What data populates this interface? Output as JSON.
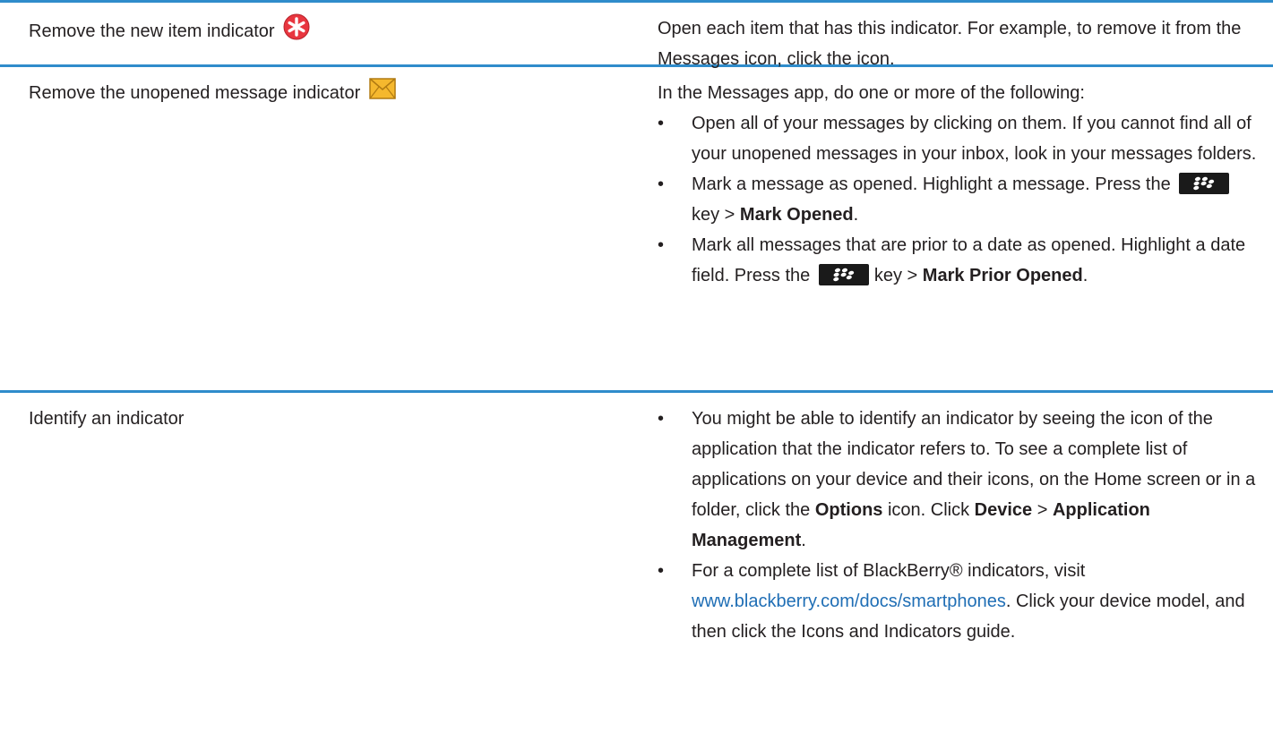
{
  "rows": [
    {
      "task": "Remove the new item indicator",
      "icon": "new-item-indicator-icon",
      "description": "Open each item that has this indicator. For example, to remove it from the Messages icon, click the icon."
    },
    {
      "task": "Remove the unopened message indicator",
      "icon": "unopened-message-envelope-icon",
      "intro": "In the Messages app, do one or more of the following:",
      "bullets": [
        {
          "text": "Open all of your messages by clicking on them. If you cannot find all of your unopened messages in your inbox, look in your messages folders."
        },
        {
          "pre": "Mark a message as opened. Highlight a message. Press the",
          "key": "blackberry-menu-key-icon",
          "mid": "key >",
          "bold": "Mark Opened",
          "post": "."
        },
        {
          "pre": "Mark all messages that are prior to a date as opened. Highlight a date field. Press the",
          "key": "blackberry-menu-key-icon",
          "mid": "key >",
          "bold": "Mark Prior Opened",
          "post": "."
        }
      ]
    },
    {
      "task": "Identify an indicator",
      "bullets": [
        {
          "pre": "You might be able to identify an indicator by seeing the icon of the application that the indicator refers to. To see a complete list of applications on your device and their icons, on the Home screen or in a folder, click the",
          "bold1": "Options",
          "mid1": "icon. Click",
          "bold2": "Device",
          "mid2": ">",
          "bold3": "Application Management",
          "post": "."
        },
        {
          "pre": "For a complete list of BlackBerry® indicators, visit",
          "link": "www.blackberry.com/docs/smartphones",
          "post": ". Click your device model, and then click the Icons and Indicators guide."
        }
      ]
    }
  ],
  "bullet_char": "•",
  "colors": {
    "rule": "#2f8ccb",
    "text": "#231f20",
    "link": "#1f6eb5",
    "new_item_red": "#e8363f",
    "envelope_yellow": "#f5b82e"
  }
}
